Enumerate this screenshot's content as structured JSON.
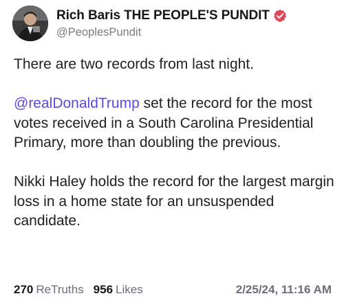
{
  "author": {
    "display_name": "Rich Baris THE PEOPLE'S PUNDIT",
    "handle": "@PeoplesPundit",
    "avatar_icon": "user-avatar",
    "verified_icon": "verified-badge-icon",
    "verified_color": "#e0455a"
  },
  "post": {
    "line1": "There are two records from last night.",
    "mention": "@realDonaldTrump",
    "para2_rest": " set the record for the most votes received in a South Carolina Presidential Primary, more than doubling the previous.",
    "para3": "Nikki Haley holds the record for the largest margin loss in a home state for an unsuspended candidate.",
    "mention_color": "#5b48d6"
  },
  "stats": {
    "retruths_count": "270",
    "retruths_label": "ReTruths",
    "likes_count": "956",
    "likes_label": "Likes",
    "timestamp": "2/25/24, 11:16 AM"
  }
}
